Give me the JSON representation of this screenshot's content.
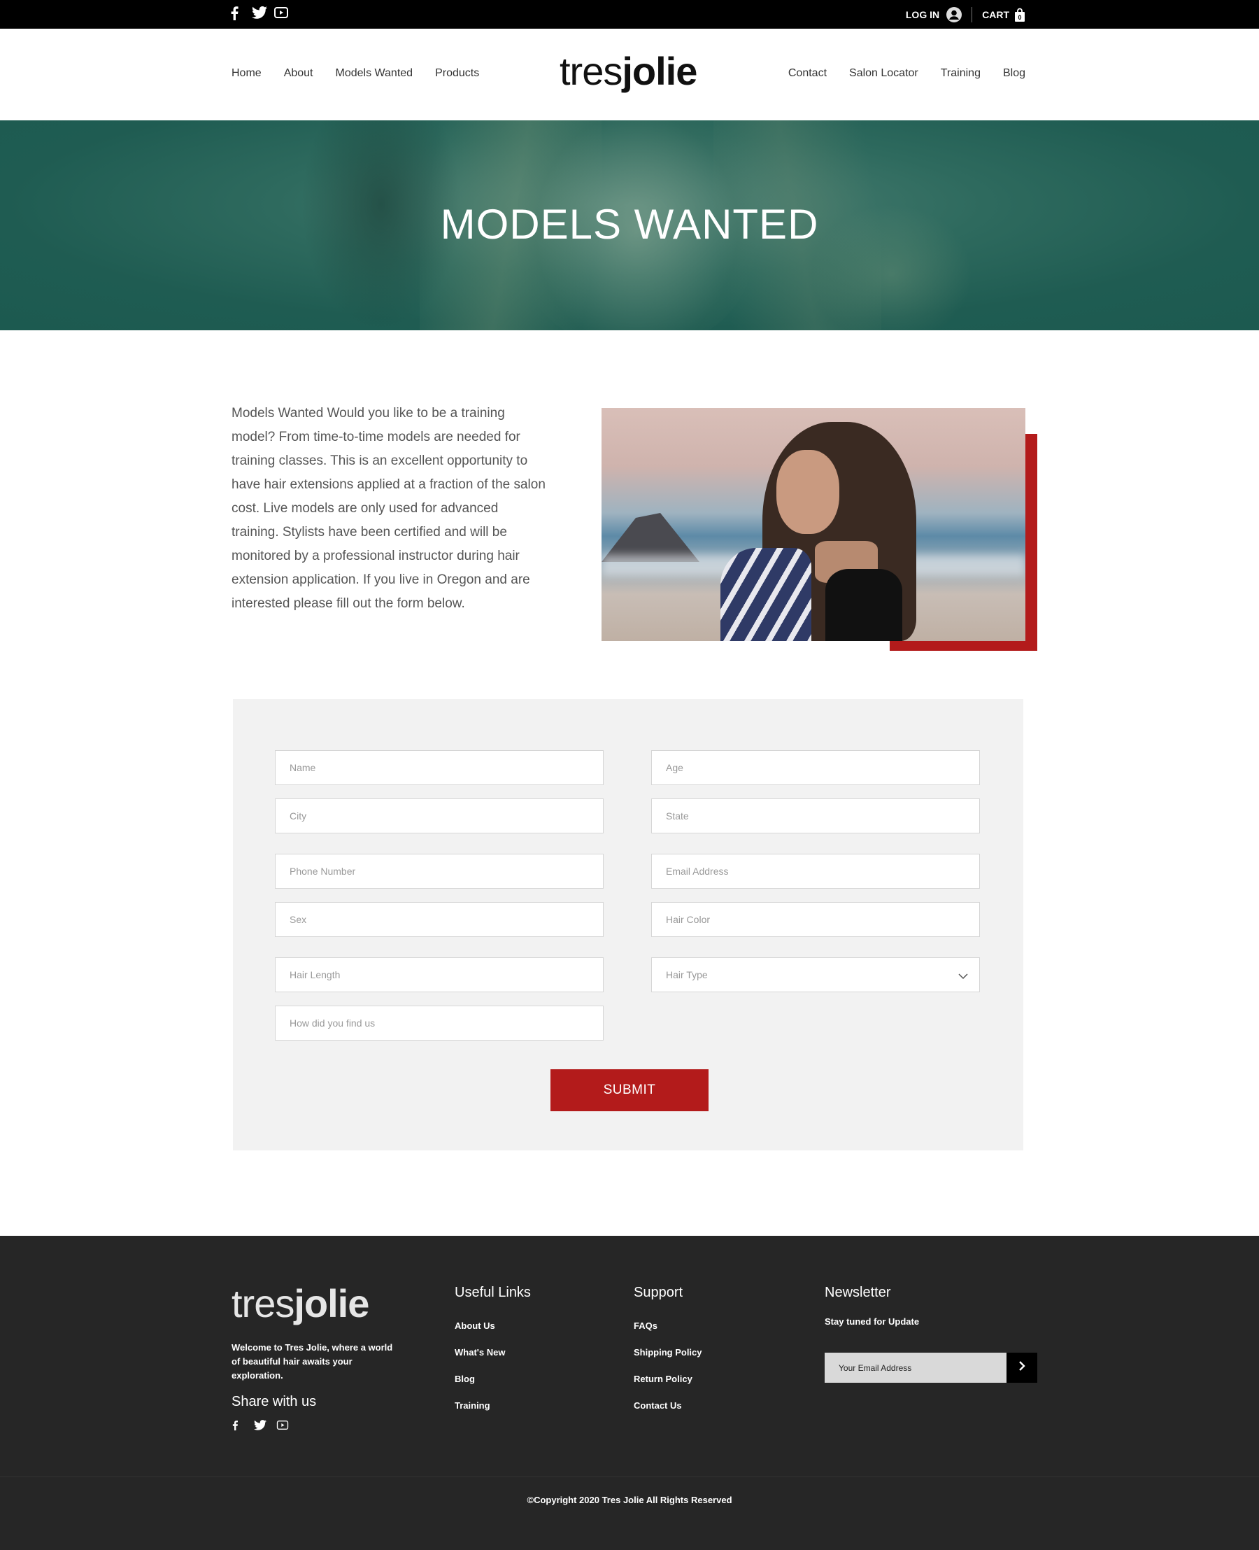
{
  "topbar": {
    "social_icons": [
      "facebook-icon",
      "twitter-icon",
      "youtube-icon"
    ],
    "login_label": "LOG IN",
    "cart_label": "CART"
  },
  "header": {
    "logo_light": "tres",
    "logo_bold": "jolie",
    "nav_left": [
      "Home",
      "About",
      "Models Wanted",
      "Products"
    ],
    "nav_right": [
      "Contact",
      "Salon Locator",
      "Training",
      "Blog"
    ]
  },
  "hero": {
    "title": "MODELS WANTED"
  },
  "intro": {
    "text": "Models Wanted Would you like to be a training model? From time-to-time models are needed for training classes. This is an excellent opportunity to have hair extensions applied at a fraction of the salon cost. Live models are only used for advanced training. Stylists have been certified and will be monitored by a professional instructor during hair extension application. If you live in Oregon and are interested please fill out the form below."
  },
  "form": {
    "name": "Name",
    "age": "Age",
    "city": "City",
    "state": "State",
    "phone": "Phone Number",
    "email": "Email Address",
    "sex": "Sex",
    "hair_color": "Hair Color",
    "hair_length": "Hair Length",
    "hair_type": "Hair Type",
    "how_found": "How did you find us",
    "submit_label": "SUBMIT"
  },
  "footer": {
    "logo_light": "tres",
    "logo_bold": "jolie",
    "welcome": "Welcome to Tres Jolie, where a world of beautiful hair awaits your exploration.",
    "share_heading": "Share with us",
    "useful_links_heading": "Useful Links",
    "useful_links": [
      "About Us",
      "What's New",
      "Blog",
      "Training"
    ],
    "support_heading": "Support",
    "support_links": [
      "FAQs",
      "Shipping Policy",
      "Return Policy",
      "Contact Us"
    ],
    "newsletter_heading": "Newsletter",
    "newsletter_sub": "Stay tuned for Update",
    "newsletter_placeholder": "Your Email Address",
    "copyright": "©Copyright 2020 Tres Jolie All Rights Reserved"
  },
  "colors": {
    "accent_red": "#b31b1b",
    "hero_teal": "#2e6a5e",
    "footer_bg": "#262626"
  }
}
